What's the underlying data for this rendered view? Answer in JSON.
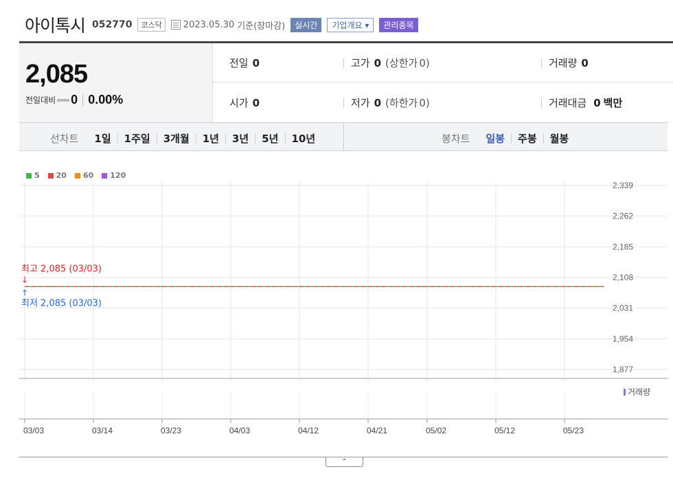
{
  "header": {
    "name": "아이톡시",
    "code": "052770",
    "market": "코스닥",
    "date": "2023.05.30",
    "basis": "기준(장마감)",
    "realtime_btn": "실시간",
    "corp_btn": "기업개요",
    "corp_btn_arrow": "▾",
    "mgmt_btn": "관리종목"
  },
  "quote": {
    "price": "2,085",
    "diff_label": "전일대비",
    "diff_value": "0",
    "diff_pct": "0.00%",
    "prev_label": "전일",
    "prev_value": "0",
    "high_label": "고가",
    "high_value": "0",
    "high_limit_label": "(상한가",
    "high_limit_value": "0)",
    "volume_label": "거래량",
    "volume_value": "0",
    "open_label": "시가",
    "open_value": "0",
    "low_label": "저가",
    "low_value": "0",
    "low_limit_label": "(하한가",
    "low_limit_value": "0)",
    "amount_label": "거래대금",
    "amount_value": "0",
    "amount_unit": "백만"
  },
  "tabs": {
    "line_header": "선차트",
    "line_items": [
      "1일",
      "1주일",
      "3개월",
      "1년",
      "3년",
      "5년",
      "10년"
    ],
    "candle_header": "봉차트",
    "candle_items": [
      "일봉",
      "주봉",
      "월봉"
    ],
    "candle_active": 0
  },
  "legend": [
    {
      "label": "5",
      "color": "#44b244"
    },
    {
      "label": "20",
      "color": "#e84545"
    },
    {
      "label": "60",
      "color": "#f08a1c"
    },
    {
      "label": "120",
      "color": "#a05ad8"
    }
  ],
  "annotations": {
    "high": "최고 2,085 (03/03)",
    "low": "최저 2,085 (03/03)",
    "high_arrow": "↓",
    "low_arrow": "↑",
    "high_color": "#e02020",
    "low_color": "#2266dd"
  },
  "volume_label": "거래량",
  "toggle_icon": "chevron-up-icon",
  "chart_data": {
    "type": "line",
    "x": [
      "03/03",
      "03/14",
      "03/23",
      "04/03",
      "04/12",
      "04/21",
      "05/02",
      "05/12",
      "05/23"
    ],
    "y_ticks": [
      2339,
      2262,
      2185,
      2108,
      2031,
      1954,
      1877
    ],
    "y_tick_labels": [
      "2,339",
      "2,262",
      "2,185",
      "2,108",
      "2,031",
      "1,954",
      "1,877"
    ],
    "ylim": [
      1877,
      2339
    ],
    "series": [
      {
        "name": "5",
        "values": [
          2085,
          2085,
          2085,
          2085,
          2085,
          2085,
          2085,
          2085,
          2085
        ],
        "color": "#44b244"
      },
      {
        "name": "20",
        "values": [
          2085,
          2085,
          2085,
          2085,
          2085,
          2085,
          2085,
          2085,
          2085
        ],
        "color": "#e84545"
      }
    ],
    "grid": true
  }
}
